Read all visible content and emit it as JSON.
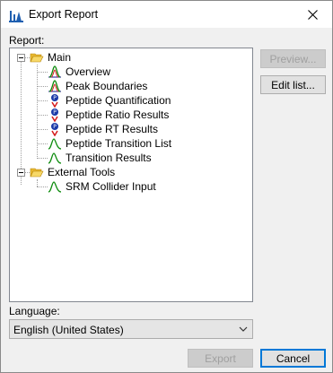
{
  "window": {
    "title": "Export Report"
  },
  "report": {
    "label": "Report:",
    "groups": [
      {
        "label": "Main",
        "items": [
          {
            "label": "Overview",
            "icon": "peak-chart-icon"
          },
          {
            "label": "Peak Boundaries",
            "icon": "peak-chart-icon"
          },
          {
            "label": "Peptide Quantification",
            "icon": "peptide-icon"
          },
          {
            "label": "Peptide Ratio Results",
            "icon": "peptide-icon"
          },
          {
            "label": "Peptide RT Results",
            "icon": "peptide-icon"
          },
          {
            "label": "Peptide Transition List",
            "icon": "transition-icon"
          },
          {
            "label": "Transition Results",
            "icon": "transition-icon"
          }
        ]
      },
      {
        "label": "External Tools",
        "items": [
          {
            "label": "SRM Collider Input",
            "icon": "transition-icon"
          }
        ]
      }
    ]
  },
  "buttons": {
    "preview": "Preview...",
    "edit_list": "Edit list...",
    "export": "Export",
    "cancel": "Cancel"
  },
  "language": {
    "label": "Language:",
    "selected": "English (United States)"
  },
  "colors": {
    "folder": "#f3c94c",
    "peak_green": "#0a8a0a",
    "peptide_blue": "#1a3aa8",
    "peptide_red": "#d41a1a",
    "accent": "#0078d7"
  }
}
